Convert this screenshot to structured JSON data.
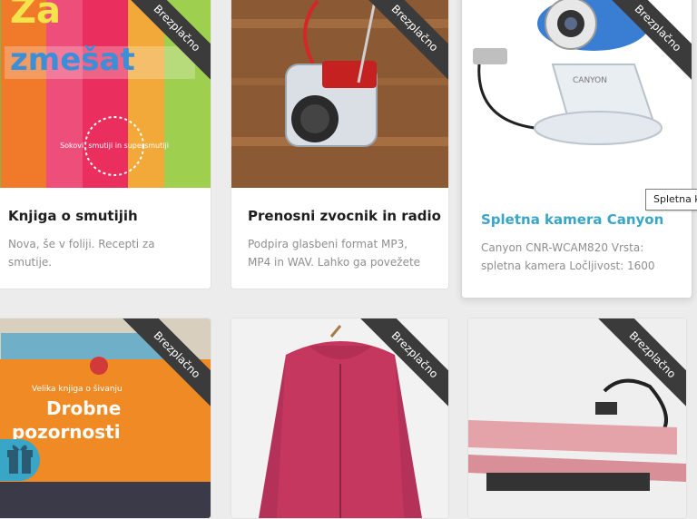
{
  "cards": [
    {
      "title": "Knjiga o smutijih",
      "description": "Nova, še v foliji. Recepti za smutije.",
      "badge": "Brezplačno",
      "cover_text": [
        "Za",
        "zmešat",
        "Sokovi, smutiji in supersmutiji"
      ]
    },
    {
      "title": "Prenosni zvocnik in radio",
      "description": "Podpira glasbeni format MP3, MP4 in WAV. Lahko ga povežete",
      "badge": "Brezplačno"
    },
    {
      "title": "Spletna kamera Canyon",
      "description": "Canyon CNR-WCAM820 Vrsta: spletna kamera Ločljivost: 1600",
      "badge": "Brezplačno",
      "cover_text": [
        "CANYON"
      ]
    },
    {
      "badge": "Brezplačno",
      "cover_text": [
        "Velika knjiga o šivanju",
        "Drobne",
        "pozornosti"
      ]
    },
    {
      "badge": "Brezplačno"
    },
    {
      "badge": "Brezplačno"
    }
  ],
  "tooltip": "Spletna k",
  "gift_icon": "gift-icon",
  "colors": {
    "accent": "#3aa6c7",
    "ribbon": "#3b3b3b"
  }
}
